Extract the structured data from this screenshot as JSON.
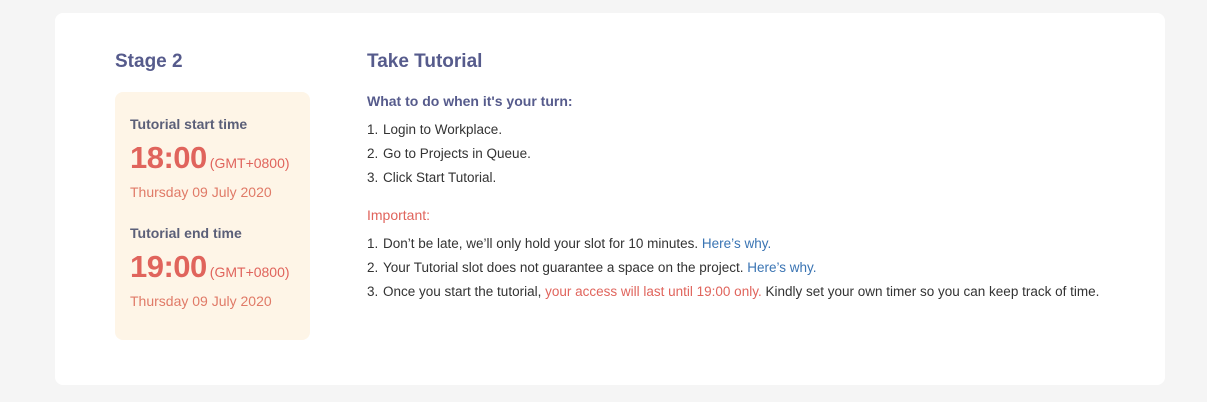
{
  "stage": {
    "title": "Stage 2"
  },
  "tutorial_times": {
    "start": {
      "label": "Tutorial start time",
      "time": "18:00",
      "timezone": "(GMT+0800)",
      "date": "Thursday 09 July 2020"
    },
    "end": {
      "label": "Tutorial end time",
      "time": "19:00",
      "timezone": "(GMT+0800)",
      "date": "Thursday 09 July 2020"
    }
  },
  "instructions": {
    "title": "Take Tutorial",
    "steps_heading": "What to do when it's your turn:",
    "steps": [
      {
        "num": "1.",
        "text": "Login to Workplace."
      },
      {
        "num": "2.",
        "text": "Go to Projects in Queue."
      },
      {
        "num": "3.",
        "text": "Click Start Tutorial."
      }
    ],
    "important_heading": "Important:",
    "important": [
      {
        "num": "1.",
        "text": "Don’t be late, we’ll only hold your slot for 10 minutes. ",
        "link": "Here’s why."
      },
      {
        "num": "2.",
        "text": "Your Tutorial slot does not guarantee a space on the project. ",
        "link": "Here’s why."
      },
      {
        "num": "3.",
        "text_before": "Once you start the tutorial, ",
        "highlight": "your access will last until 19:00 only.",
        "text_after": " Kindly set your own timer so you can keep track of time."
      }
    ]
  },
  "colors": {
    "heading": "#565b8c",
    "accent": "#e0645c",
    "link": "#3a74b3",
    "time_box_bg": "#fef5e7"
  }
}
